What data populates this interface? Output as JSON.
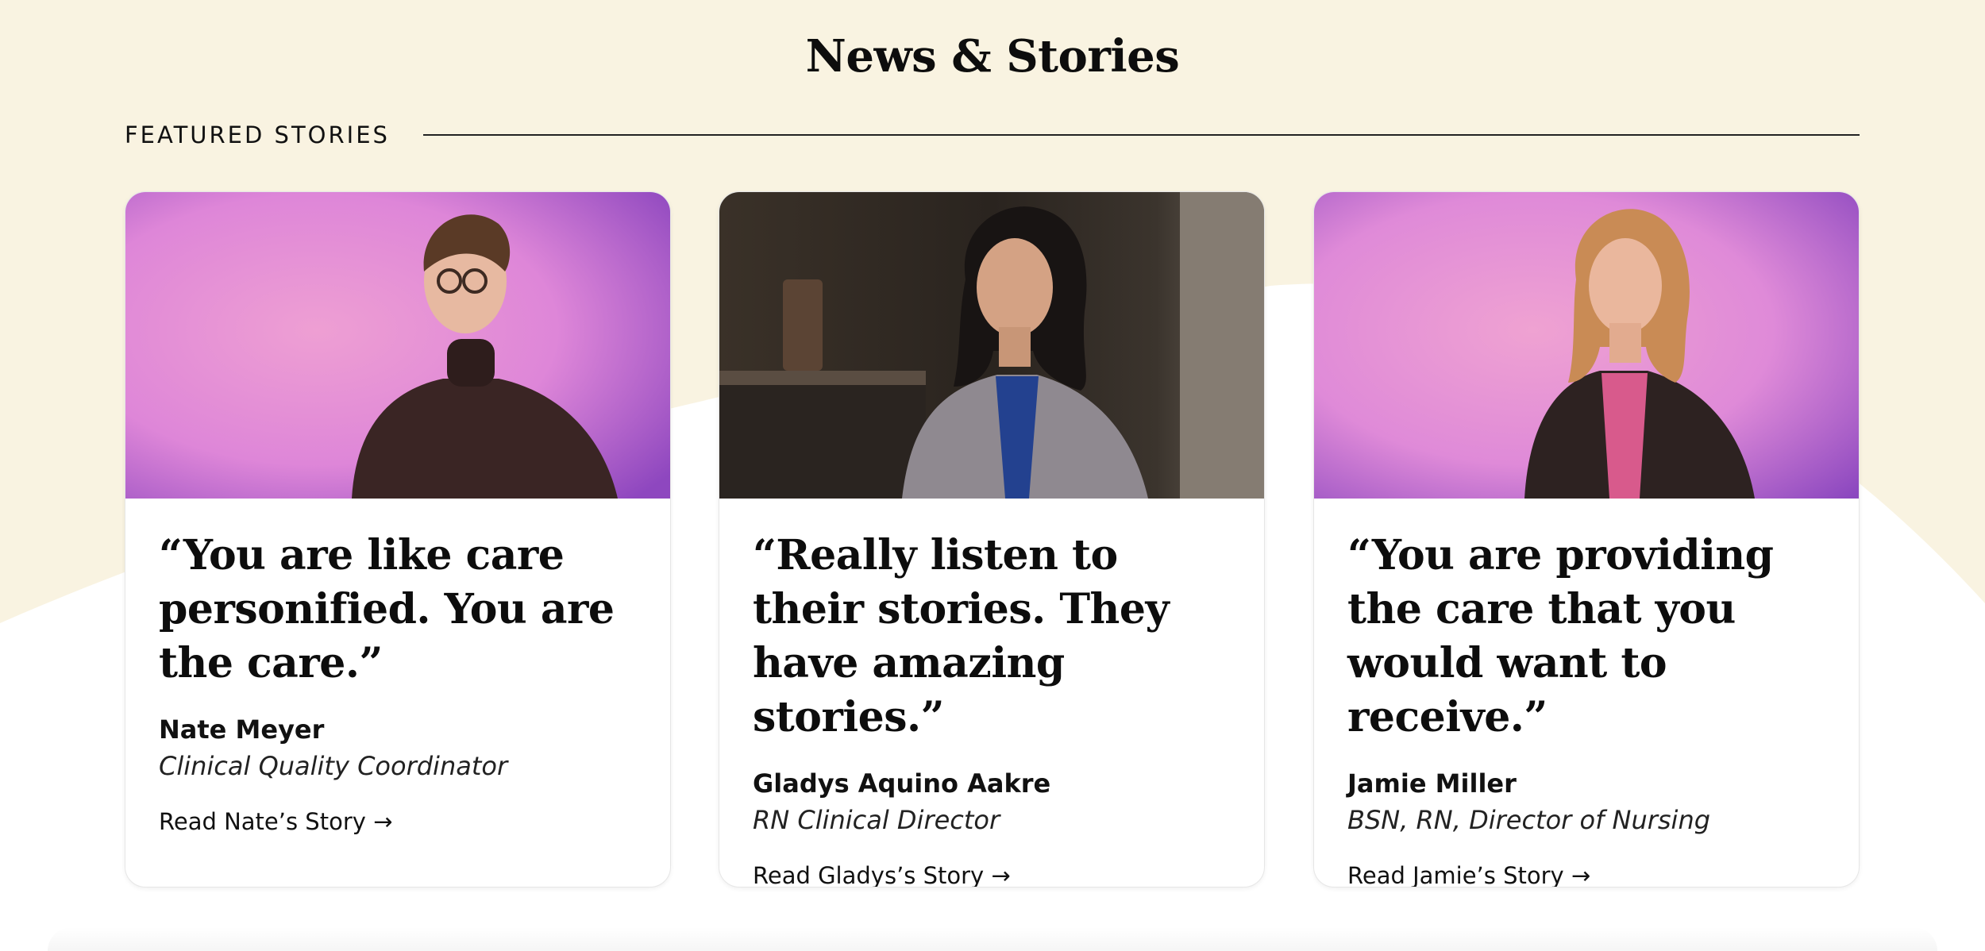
{
  "page": {
    "title": "News & Stories",
    "section_label": "FEATURED STORIES"
  },
  "colors": {
    "background_cream": "#f9f3e1",
    "card_white": "#ffffff",
    "photo_pink": "#e48bd1",
    "photo_purple": "#9a4fcc"
  },
  "stories": [
    {
      "quote": "“You are like care personified. You are the care.”",
      "name": "Nate Meyer",
      "role": "Clinical Quality Coordinator",
      "link": "Read Nate’s Story →",
      "photo": "portrait-nate"
    },
    {
      "quote": "“Really listen to their stories. They have amazing stories.”",
      "name": "Gladys Aquino Aakre",
      "role": "RN Clinical Director",
      "link": "Read Gladys’s Story →",
      "photo": "portrait-gladys"
    },
    {
      "quote": "“You are providing the care that you would want to receive.”",
      "name": "Jamie Miller",
      "role": "BSN, RN, Director of Nursing",
      "link": "Read Jamie’s Story →",
      "photo": "portrait-jamie"
    }
  ]
}
